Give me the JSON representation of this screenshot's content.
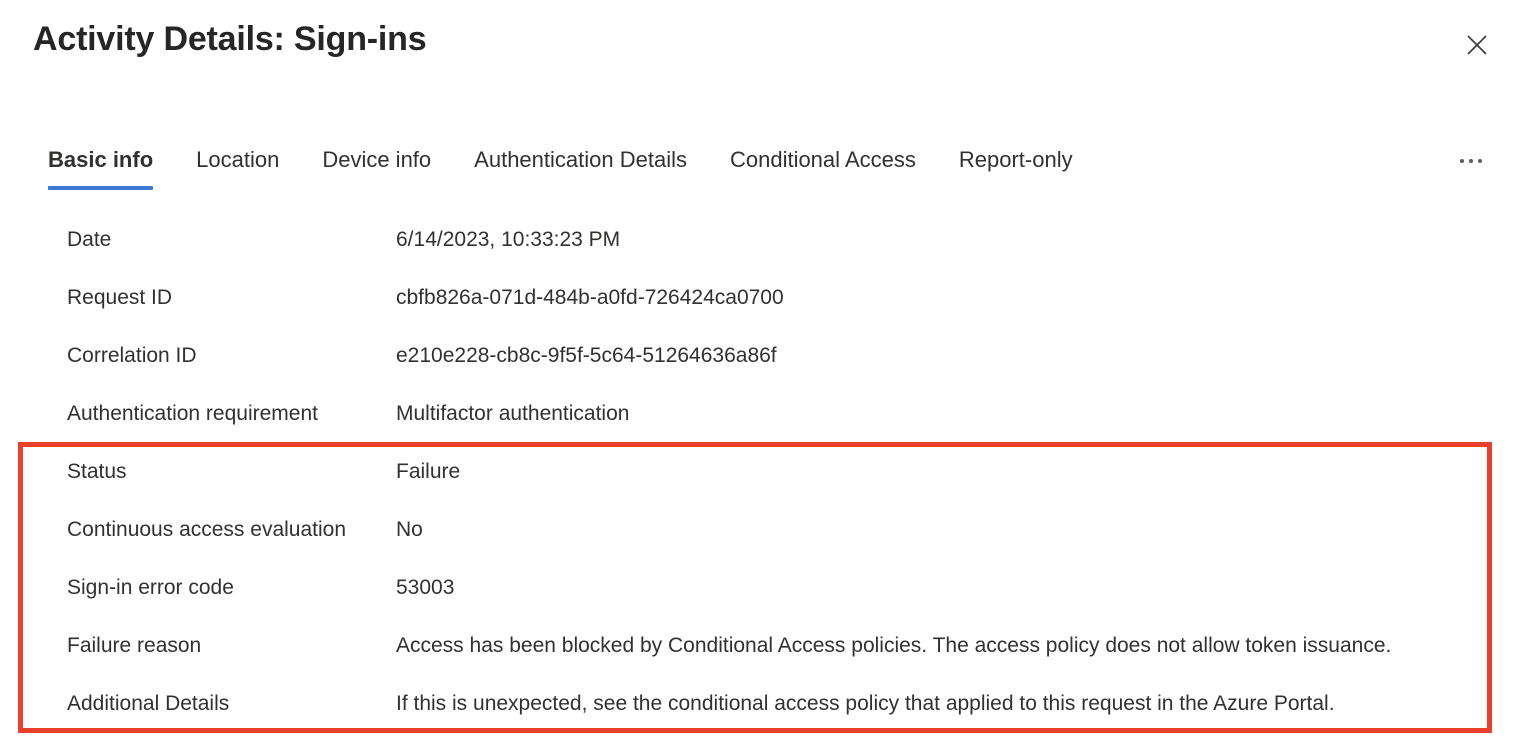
{
  "header": {
    "title": "Activity Details: Sign-ins",
    "close_icon": "close-icon",
    "close_label": "Close"
  },
  "tabs": {
    "items": [
      {
        "label": "Basic info",
        "active": true
      },
      {
        "label": "Location",
        "active": false
      },
      {
        "label": "Device info",
        "active": false
      },
      {
        "label": "Authentication Details",
        "active": false
      },
      {
        "label": "Conditional Access",
        "active": false
      },
      {
        "label": "Report-only",
        "active": false
      }
    ],
    "overflow_icon": "ellipsis-icon",
    "active_underline_color": "#3B78D4"
  },
  "details": {
    "rows": [
      {
        "label": "Date",
        "value": "6/14/2023, 10:33:23 PM"
      },
      {
        "label": "Request ID",
        "value": "cbfb826a-071d-484b-a0fd-726424ca0700"
      },
      {
        "label": "Correlation ID",
        "value": "e210e228-cb8c-9f5f-5c64-51264636a86f"
      },
      {
        "label": "Authentication requirement",
        "value": "Multifactor authentication"
      },
      {
        "label": "Status",
        "value": "Failure"
      },
      {
        "label": "Continuous access evaluation",
        "value": "No"
      },
      {
        "label": "Sign-in error code",
        "value": "53003"
      },
      {
        "label": "Failure reason",
        "value": "Access has been blocked by Conditional Access policies. The access policy does not allow token issuance."
      },
      {
        "label": "Additional Details",
        "value": "If this is unexpected, see the conditional access policy that applied to this request in the Azure Portal."
      }
    ]
  },
  "highlight": {
    "color": "#E8402A",
    "covers_rows": [
      "Status",
      "Continuous access evaluation",
      "Sign-in error code",
      "Failure reason",
      "Additional Details"
    ]
  }
}
